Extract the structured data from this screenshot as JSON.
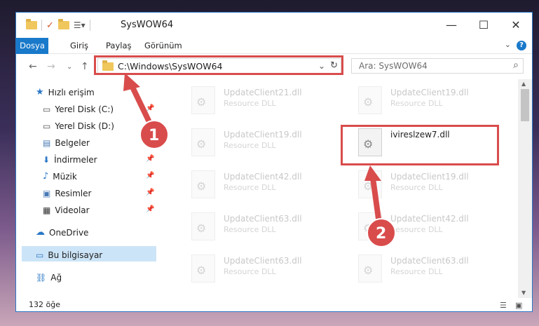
{
  "window": {
    "title": "SysWOW64",
    "min_label": "—",
    "max_label": "☐",
    "close_label": "✕"
  },
  "ribbon": {
    "tabs": [
      "Dosya",
      "Giriş",
      "Paylaş",
      "Görünüm"
    ]
  },
  "address": {
    "path": "C:\\Windows\\SysWOW64",
    "search_placeholder": "Ara: SysWOW64"
  },
  "sidebar": {
    "items": [
      {
        "label": "Hızlı erişim",
        "icon": "star-icon"
      },
      {
        "label": "Yerel Disk (C:)",
        "icon": "drive-icon",
        "pinned": true
      },
      {
        "label": "Yerel Disk (D:)",
        "icon": "drive-icon",
        "pinned": true
      },
      {
        "label": "Belgeler",
        "icon": "document-icon",
        "pinned": true
      },
      {
        "label": "İndirmeler",
        "icon": "download-icon",
        "pinned": true
      },
      {
        "label": "Müzik",
        "icon": "music-icon",
        "pinned": true
      },
      {
        "label": "Resimler",
        "icon": "pictures-icon",
        "pinned": true
      },
      {
        "label": "Videolar",
        "icon": "video-icon",
        "pinned": true
      },
      {
        "label": "OneDrive",
        "icon": "cloud-icon"
      },
      {
        "label": "Bu bilgisayar",
        "icon": "computer-icon"
      },
      {
        "label": "Ağ",
        "icon": "network-icon"
      }
    ]
  },
  "files": [
    {
      "name": "UpdateClient21.dll",
      "type": "Resource DLL"
    },
    {
      "name": "UpdateClient19.dll",
      "type": "Resource DLL"
    },
    {
      "name": "UpdateClient19.dll",
      "type": "Resource DLL"
    },
    {
      "name": "ivireslzew7.dll",
      "type": ""
    },
    {
      "name": "UpdateClient42.dll",
      "type": "Resource DLL"
    },
    {
      "name": "UpdateClient19.dll",
      "type": "Resource DLL"
    },
    {
      "name": "UpdateClient63.dll",
      "type": "Resource DLL"
    },
    {
      "name": "UpdateClient42.dll",
      "type": "Resource DLL"
    },
    {
      "name": "UpdateClient63.dll",
      "type": "Resource DLL"
    },
    {
      "name": "UpdateClient63.dll",
      "type": "Resource DLL"
    }
  ],
  "status": {
    "count": "132 öğe"
  },
  "annotations": {
    "step1": "1",
    "step2": "2",
    "color": "#d94c4c"
  }
}
